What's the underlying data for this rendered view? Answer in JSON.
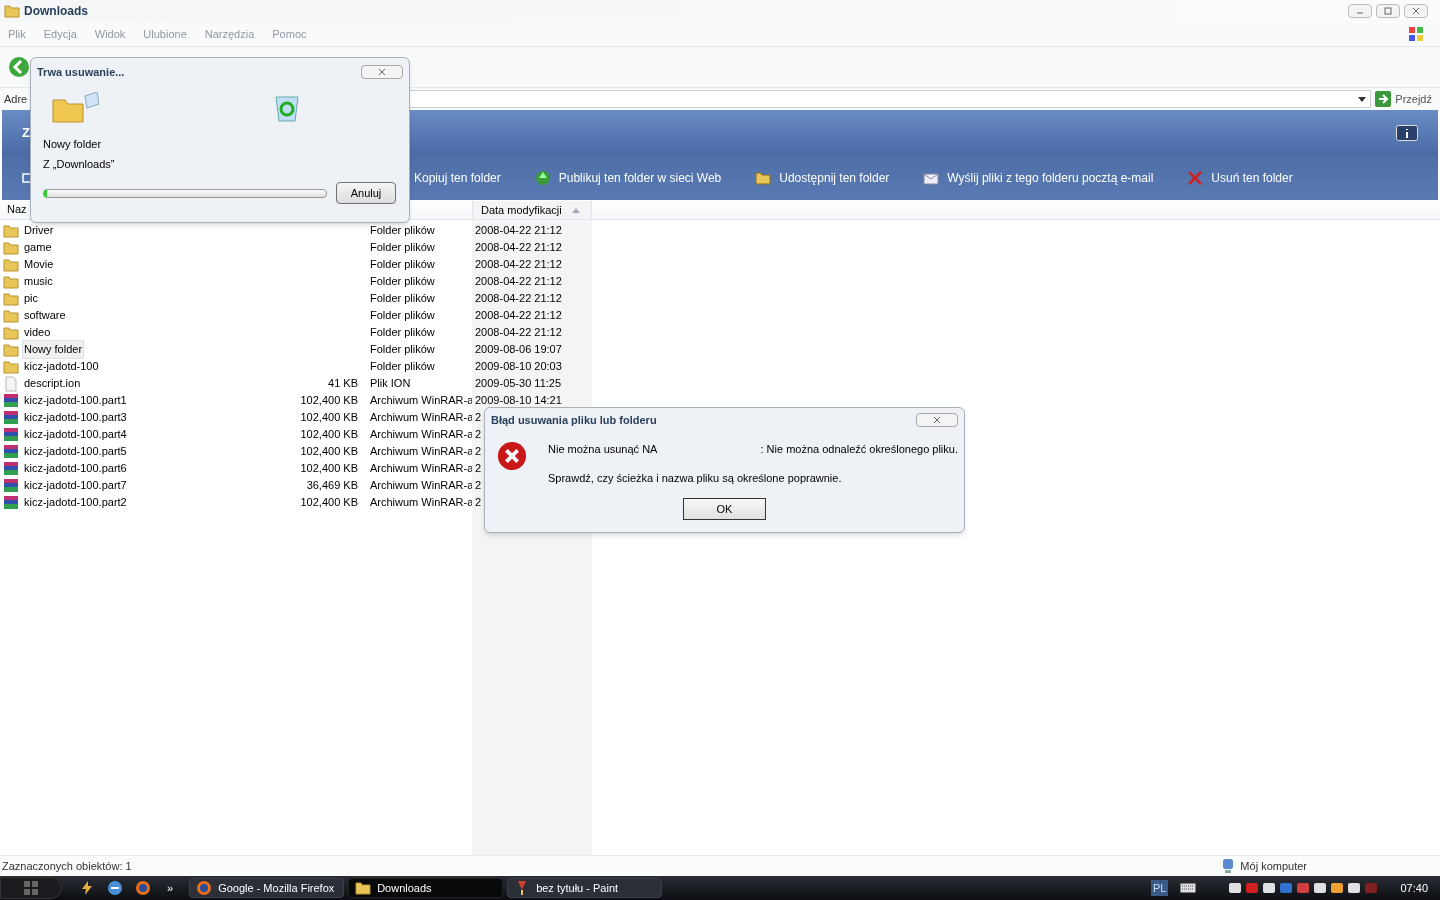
{
  "window": {
    "title": "Downloads"
  },
  "menu": [
    "Plik",
    "Edycja",
    "Widok",
    "Ulubione",
    "Narzędzia",
    "Pomoc"
  ],
  "address": {
    "label": "Adre",
    "go": "Przejdź"
  },
  "banner": {
    "title": "Z"
  },
  "tasks": [
    {
      "label": "Kopiuj ten folder",
      "kind": "none"
    },
    {
      "label": "Publikuj ten folder w sieci Web",
      "kind": "globe"
    },
    {
      "label": "Udostępnij ten folder",
      "kind": "share"
    },
    {
      "label": "Wyślij pliki z tego folderu pocztą e-mail",
      "kind": "mail"
    },
    {
      "label": "Usuń ten folder",
      "kind": "delete"
    }
  ],
  "columns": [
    {
      "label": "Naz"
    },
    {
      "label": "Data modyfikacji",
      "sorted": true
    }
  ],
  "rows": [
    {
      "name": "Driver",
      "size": "",
      "type": "Folder plików",
      "date": "2008-04-22 21:12",
      "kind": "folder",
      "selected": false
    },
    {
      "name": "game",
      "size": "",
      "type": "Folder plików",
      "date": "2008-04-22 21:12",
      "kind": "folder",
      "selected": false
    },
    {
      "name": "Movie",
      "size": "",
      "type": "Folder plików",
      "date": "2008-04-22 21:12",
      "kind": "folder",
      "selected": false
    },
    {
      "name": "music",
      "size": "",
      "type": "Folder plików",
      "date": "2008-04-22 21:12",
      "kind": "folder",
      "selected": false
    },
    {
      "name": "pic",
      "size": "",
      "type": "Folder plików",
      "date": "2008-04-22 21:12",
      "kind": "folder",
      "selected": false
    },
    {
      "name": "software",
      "size": "",
      "type": "Folder plików",
      "date": "2008-04-22 21:12",
      "kind": "folder",
      "selected": false
    },
    {
      "name": "video",
      "size": "",
      "type": "Folder plików",
      "date": "2008-04-22 21:12",
      "kind": "folder",
      "selected": false
    },
    {
      "name": "Nowy folder",
      "size": "",
      "type": "Folder plików",
      "date": "2009-08-06 19:07",
      "kind": "folder",
      "selected": true
    },
    {
      "name": "kicz-jadotd-100",
      "size": "",
      "type": "Folder plików",
      "date": "2009-08-10 20:03",
      "kind": "folder",
      "selected": false
    },
    {
      "name": "descript.ion",
      "size": "41 KB",
      "type": "Plik ION",
      "date": "2009-05-30 11:25",
      "kind": "file",
      "selected": false
    },
    {
      "name": "kicz-jadotd-100.part1",
      "size": "102,400 KB",
      "type": "Archiwum WinRAR-a",
      "date": "2009-08-10 14:21",
      "kind": "archive",
      "selected": false
    },
    {
      "name": "kicz-jadotd-100.part3",
      "size": "102,400 KB",
      "type": "Archiwum WinRAR-a",
      "date": "2",
      "kind": "archive",
      "selected": false
    },
    {
      "name": "kicz-jadotd-100.part4",
      "size": "102,400 KB",
      "type": "Archiwum WinRAR-a",
      "date": "2",
      "kind": "archive",
      "selected": false
    },
    {
      "name": "kicz-jadotd-100.part5",
      "size": "102,400 KB",
      "type": "Archiwum WinRAR-a",
      "date": "2",
      "kind": "archive",
      "selected": false
    },
    {
      "name": "kicz-jadotd-100.part6",
      "size": "102,400 KB",
      "type": "Archiwum WinRAR-a",
      "date": "2",
      "kind": "archive",
      "selected": false
    },
    {
      "name": "kicz-jadotd-100.part7",
      "size": "36,469 KB",
      "type": "Archiwum WinRAR-a",
      "date": "2",
      "kind": "archive",
      "selected": false
    },
    {
      "name": "kicz-jadotd-100.part2",
      "size": "102,400 KB",
      "type": "Archiwum WinRAR-a",
      "date": "2",
      "kind": "archive",
      "selected": false
    }
  ],
  "status_bar": {
    "left": "Zaznaczonych obiektów: 1",
    "right": "Mój komputer"
  },
  "progress_dialog": {
    "title": "Trwa usuwanie...",
    "item": "Nowy folder",
    "source": "Z „Downloads”",
    "level": 0.01,
    "cancel": "Anuluj"
  },
  "error_dialog": {
    "title": "Błąd usuwania pliku lub folderu",
    "message_start": "Nie można usunąć NA",
    "message_end": ": Nie można odnaleźć określonego pliku.",
    "hint": "Sprawdź, czy ścieżka i nazwa pliku są określone poprawnie.",
    "ok": "OK"
  },
  "taskbar": {
    "more": "»",
    "buttons": [
      {
        "label": "Google - Mozilla Firefox",
        "kind": "firefox",
        "selected": false
      },
      {
        "label": "Downloads",
        "kind": "folder",
        "selected": true
      },
      {
        "label": "bez tytułu - Paint",
        "kind": "paint",
        "selected": false
      }
    ],
    "language": "PL",
    "clock": "07:40"
  }
}
